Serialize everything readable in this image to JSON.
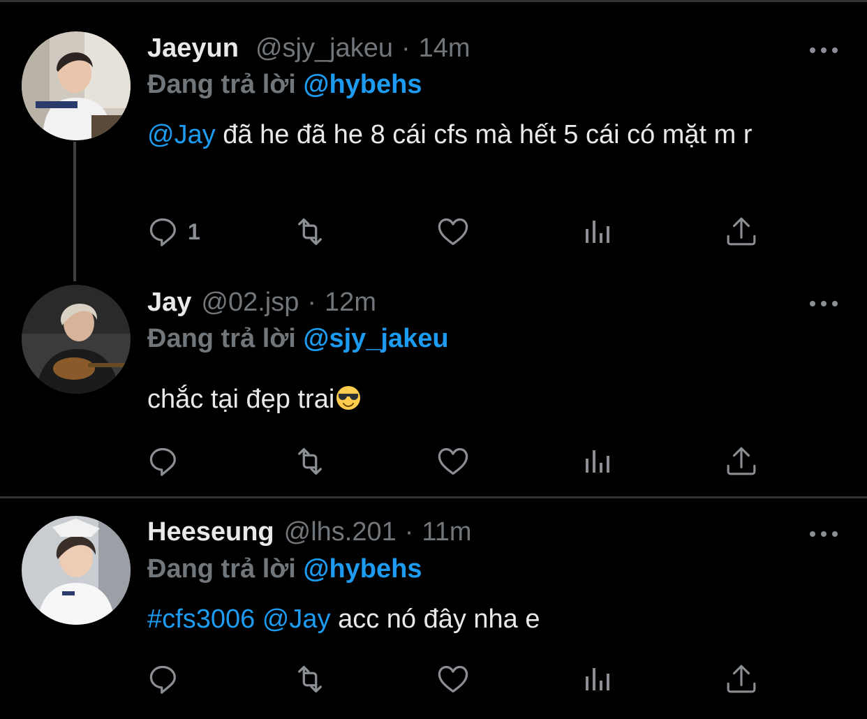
{
  "tweets": [
    {
      "name": "Jaeyun",
      "handle": "@sjy_jakeu",
      "dot": "·",
      "time": "14m",
      "reply_label": "Đang trả lời",
      "reply_to": "@hybehs",
      "mention": "@Jay",
      "text": " đã he đã he 8 cái cfs mà hết 5 cái có mặt m r",
      "reply_count": "1"
    },
    {
      "name": "Jay",
      "handle": "@02.jsp",
      "dot": "·",
      "time": "12m",
      "reply_label": "Đang trả lời",
      "reply_to": "@sjy_jakeu",
      "text": "chắc tại đẹp trai",
      "emoji": "smiling-face-with-sunglasses"
    },
    {
      "name": "Heeseung",
      "handle": "@lhs.201",
      "dot": "·",
      "time": "11m",
      "reply_label": "Đang trả lời",
      "reply_to": "@hybehs",
      "hashtag": "#cfs3006",
      "mention": "@Jay",
      "text": " acc nó đây nha e"
    }
  ],
  "icons": {
    "reply": "reply-icon",
    "retweet": "retweet-icon",
    "like": "like-icon",
    "views": "views-icon",
    "share": "share-icon",
    "more": "more-icon"
  },
  "colors": {
    "background": "#000000",
    "link": "#1d9bf0",
    "secondary": "#71767b",
    "icon": "#8b8f94",
    "divider": "#2f3336"
  }
}
